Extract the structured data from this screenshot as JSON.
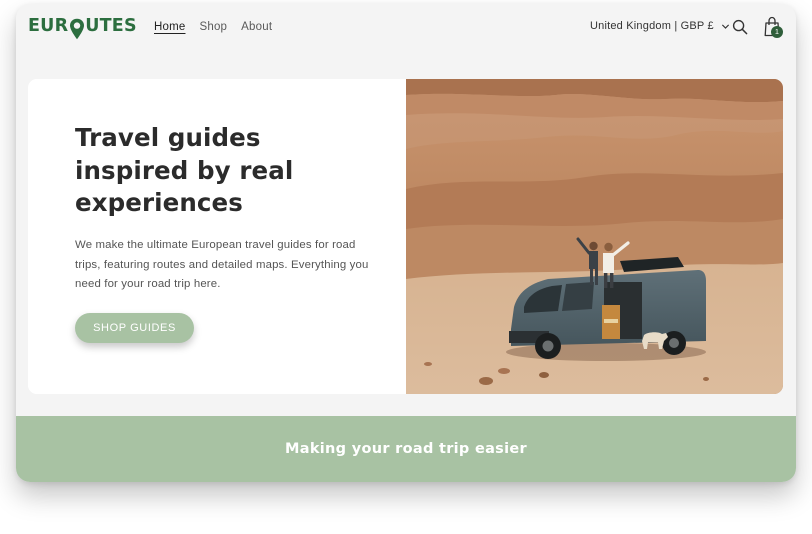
{
  "brand": {
    "logo_text_before": "EUR",
    "logo_text_after": "UTES",
    "logo_color": "#2c6e3f",
    "pin_icon": "map-pin-icon"
  },
  "nav": {
    "items": [
      {
        "label": "Home",
        "active": true
      },
      {
        "label": "Shop",
        "active": false
      },
      {
        "label": "About",
        "active": false
      }
    ]
  },
  "header": {
    "locale_label": "United Kingdom | GBP £",
    "locale_icon": "chevron-down-icon",
    "search_icon": "search-icon",
    "cart_icon": "shopping-bag-icon",
    "cart_count": "1"
  },
  "hero": {
    "title": "Travel guides inspired by real experiences",
    "body": "We make the ultimate European travel guides for road trips, featuring routes and detailed maps. Everything you need for your road trip here.",
    "cta_label": "SHOP GUIDES",
    "photo": "desert-campervan-photo"
  },
  "band": {
    "title": "Making your road trip easier"
  },
  "colors": {
    "brand_green": "#2c6e3f",
    "sage": "#a8c2a3",
    "page_bg": "#f4f4f4",
    "text_dark": "#2b2b2b"
  }
}
